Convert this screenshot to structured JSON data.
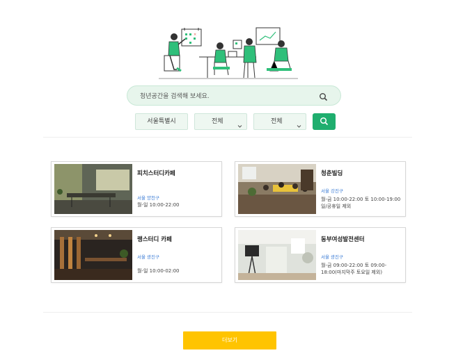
{
  "search": {
    "placeholder": "청년공간을 검색해 보세요."
  },
  "filters": {
    "region": "서울특별시",
    "district": "전체",
    "type": "전체"
  },
  "cards": [
    {
      "name": "피치스터디카페",
      "district": "서울 양천구",
      "hours": "월-일 10:00-22:00"
    },
    {
      "name": "청춘빌딩",
      "district": "서울 강진구",
      "hours": "월-금 10:00-22:00 토 10:00-19:00 일/공휴일 제외"
    },
    {
      "name": "랭스터디 카페",
      "district": "서울 광진구",
      "hours": "월-일 10:00-02:00"
    },
    {
      "name": "동부여성발전센터",
      "district": "서울 광진구",
      "hours": "월-금 09:00-22:00 토 09:00-18:00(마지막주 토요일 제외)"
    }
  ],
  "more_button": {
    "label": "더보기"
  },
  "colors": {
    "accent": "#1fae6e",
    "more": "#ffc400",
    "district_link": "#3a7bd5"
  },
  "icons": [
    "search-icon",
    "chevron-down-icon",
    "people-working-illustration"
  ]
}
